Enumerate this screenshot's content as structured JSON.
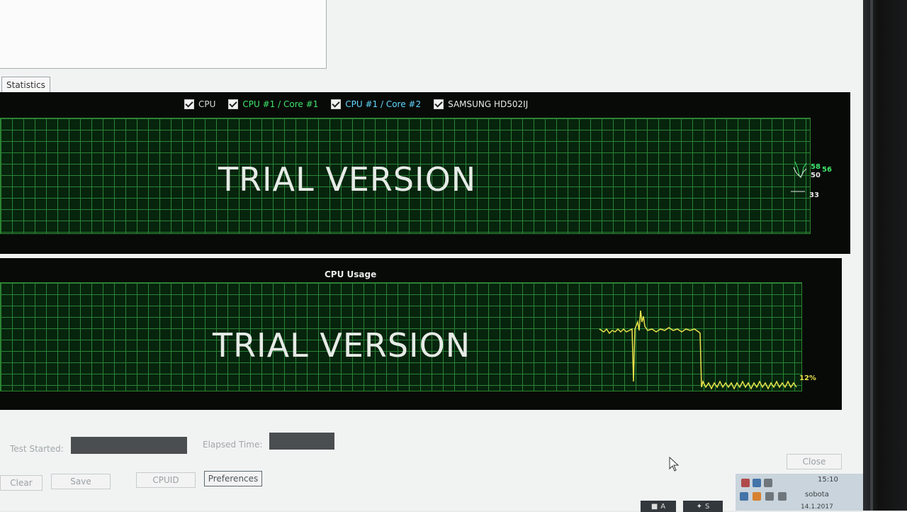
{
  "tab": {
    "label": "Statistics"
  },
  "legend": [
    {
      "label": "CPU",
      "color": "#d7d7d7"
    },
    {
      "label": "CPU #1 / Core #1",
      "color": "#3fe56b"
    },
    {
      "label": "CPU #1 / Core #2",
      "color": "#5fd8ff"
    },
    {
      "label": "SAMSUNG HD502IJ",
      "color": "#e9e9e9"
    }
  ],
  "temp_chart": {
    "watermark": "TRIAL VERSION",
    "labels": [
      "58",
      "56",
      "50",
      "33"
    ]
  },
  "usage_chart": {
    "title": "CPU Usage",
    "watermark": "TRIAL VERSION",
    "current_value": "12%"
  },
  "fields": {
    "test_started_label": "Test Started:",
    "elapsed_time_label": "Elapsed Time:"
  },
  "buttons": {
    "clear": "Clear",
    "save": "Save",
    "cpuid": "CPUID",
    "preferences": "Preferences",
    "close": "Close"
  },
  "taskbar": {
    "time": "15:10",
    "day": "sobota",
    "date": "14.1.2017",
    "app_a": "A",
    "app_s": "S"
  },
  "colors": {
    "grid": "#2c8a3a",
    "grid_bg": "#07260e",
    "usage_line": "#e9e34b"
  }
}
